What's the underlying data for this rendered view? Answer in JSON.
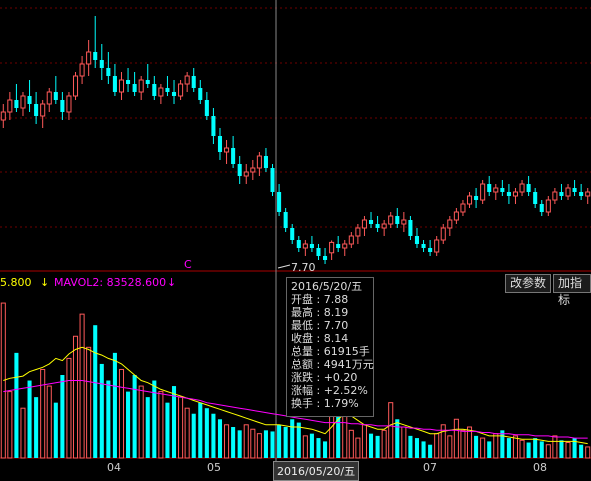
{
  "indicator": {
    "volume_label": "5.800",
    "mavol2_label": "MAVOL2: 83528.600",
    "down_arrow": "↓",
    "colors": {
      "yellow": "#ffff00",
      "magenta": "#ff00ff"
    }
  },
  "buttons": {
    "change_params": "改参数",
    "add_indicator": "加指标"
  },
  "price_low_label": "7.70",
  "marker_c": "C",
  "tooltip": {
    "date": "2016/5/20/五",
    "open": "开盘 : 7.88",
    "high": "最高 : 8.19",
    "low": "最低 : 7.70",
    "close": "收盘 : 8.14",
    "volume": "总量 : 61915手",
    "amount": "总额 : 4941万元",
    "change": "涨跌 : +0.20",
    "change_pct": "涨幅 : +2.52%",
    "turnover": "换手 : 1.79%"
  },
  "cursor_date": "2016/05/20/五",
  "chart_data": {
    "type": "bar",
    "x_ticks": [
      "04",
      "05",
      "07",
      "08"
    ],
    "colors": {
      "up": "#ff5a5a",
      "down": "#00ffff",
      "ma1": "#ffff00",
      "ma2": "#ff00ff",
      "grid": "#6e0000"
    },
    "candles": [
      [
        11.2,
        11.6,
        11.0,
        11.4
      ],
      [
        11.4,
        11.9,
        11.2,
        11.7
      ],
      [
        11.7,
        12.1,
        11.4,
        11.5
      ],
      [
        11.5,
        11.9,
        11.3,
        11.8
      ],
      [
        11.8,
        12.2,
        11.4,
        11.6
      ],
      [
        11.6,
        11.9,
        11.1,
        11.3
      ],
      [
        11.3,
        11.7,
        11.0,
        11.6
      ],
      [
        11.6,
        12.0,
        11.4,
        11.9
      ],
      [
        11.9,
        12.3,
        11.6,
        11.7
      ],
      [
        11.7,
        11.9,
        11.2,
        11.4
      ],
      [
        11.4,
        11.9,
        11.2,
        11.8
      ],
      [
        11.8,
        12.4,
        11.7,
        12.3
      ],
      [
        12.3,
        12.8,
        12.1,
        12.6
      ],
      [
        12.6,
        13.2,
        12.3,
        12.9
      ],
      [
        12.9,
        13.8,
        12.5,
        12.7
      ],
      [
        12.7,
        13.1,
        12.2,
        12.5
      ],
      [
        12.5,
        12.9,
        12.1,
        12.3
      ],
      [
        12.3,
        12.6,
        11.8,
        11.9
      ],
      [
        11.9,
        12.4,
        11.7,
        12.2
      ],
      [
        12.2,
        12.5,
        11.9,
        12.1
      ],
      [
        12.1,
        12.4,
        11.8,
        11.9
      ],
      [
        11.9,
        12.3,
        11.7,
        12.2
      ],
      [
        12.2,
        12.6,
        12.0,
        12.1
      ],
      [
        12.1,
        12.3,
        11.7,
        11.8
      ],
      [
        11.8,
        12.1,
        11.6,
        12.0
      ],
      [
        12.0,
        12.3,
        11.8,
        11.9
      ],
      [
        11.9,
        12.2,
        11.6,
        11.8
      ],
      [
        11.8,
        12.2,
        11.7,
        12.1
      ],
      [
        12.1,
        12.4,
        11.9,
        12.3
      ],
      [
        12.3,
        12.5,
        11.9,
        12.0
      ],
      [
        12.0,
        12.2,
        11.6,
        11.7
      ],
      [
        11.7,
        11.9,
        11.2,
        11.3
      ],
      [
        11.3,
        11.5,
        10.6,
        10.8
      ],
      [
        10.8,
        11.0,
        10.2,
        10.4
      ],
      [
        10.4,
        10.7,
        10.1,
        10.5
      ],
      [
        10.5,
        10.8,
        10.0,
        10.1
      ],
      [
        10.1,
        10.3,
        9.6,
        9.8
      ],
      [
        9.8,
        10.1,
        9.6,
        9.9
      ],
      [
        9.9,
        10.2,
        9.7,
        10.0
      ],
      [
        10.0,
        10.4,
        9.8,
        10.3
      ],
      [
        10.3,
        10.5,
        9.9,
        10.0
      ],
      [
        10.0,
        10.1,
        9.3,
        9.4
      ],
      [
        9.4,
        9.6,
        8.8,
        8.9
      ],
      [
        8.9,
        9.0,
        8.4,
        8.5
      ],
      [
        8.5,
        8.6,
        8.1,
        8.2
      ],
      [
        8.2,
        8.3,
        7.9,
        8.0
      ],
      [
        8.0,
        8.2,
        7.8,
        8.1
      ],
      [
        8.1,
        8.3,
        7.9,
        8.0
      ],
      [
        8.0,
        8.1,
        7.7,
        7.8
      ],
      [
        7.8,
        8.0,
        7.6,
        7.7
      ],
      [
        7.88,
        8.19,
        7.7,
        8.14
      ],
      [
        8.1,
        8.3,
        7.9,
        8.0
      ],
      [
        8.0,
        8.2,
        7.8,
        8.1
      ],
      [
        8.1,
        8.4,
        8.0,
        8.3
      ],
      [
        8.3,
        8.6,
        8.1,
        8.5
      ],
      [
        8.5,
        8.8,
        8.3,
        8.7
      ],
      [
        8.7,
        8.9,
        8.5,
        8.6
      ],
      [
        8.6,
        8.8,
        8.4,
        8.5
      ],
      [
        8.5,
        8.7,
        8.3,
        8.6
      ],
      [
        8.6,
        8.9,
        8.5,
        8.8
      ],
      [
        8.8,
        9.0,
        8.5,
        8.6
      ],
      [
        8.6,
        8.9,
        8.4,
        8.7
      ],
      [
        8.7,
        8.8,
        8.2,
        8.3
      ],
      [
        8.3,
        8.5,
        8.0,
        8.1
      ],
      [
        8.1,
        8.2,
        7.9,
        8.0
      ],
      [
        8.0,
        8.2,
        7.8,
        7.9
      ],
      [
        7.9,
        8.3,
        7.8,
        8.2
      ],
      [
        8.2,
        8.6,
        8.1,
        8.5
      ],
      [
        8.5,
        8.8,
        8.3,
        8.7
      ],
      [
        8.7,
        9.0,
        8.6,
        8.9
      ],
      [
        8.9,
        9.2,
        8.8,
        9.1
      ],
      [
        9.1,
        9.4,
        9.0,
        9.3
      ],
      [
        9.3,
        9.5,
        9.0,
        9.2
      ],
      [
        9.2,
        9.7,
        9.1,
        9.6
      ],
      [
        9.6,
        9.8,
        9.3,
        9.4
      ],
      [
        9.4,
        9.6,
        9.2,
        9.5
      ],
      [
        9.5,
        9.7,
        9.3,
        9.4
      ],
      [
        9.4,
        9.6,
        9.1,
        9.3
      ],
      [
        9.3,
        9.5,
        9.1,
        9.4
      ],
      [
        9.4,
        9.7,
        9.3,
        9.6
      ],
      [
        9.6,
        9.8,
        9.3,
        9.4
      ],
      [
        9.4,
        9.5,
        9.0,
        9.1
      ],
      [
        9.1,
        9.2,
        8.8,
        8.9
      ],
      [
        8.9,
        9.3,
        8.8,
        9.2
      ],
      [
        9.2,
        9.5,
        9.1,
        9.4
      ],
      [
        9.4,
        9.6,
        9.2,
        9.3
      ],
      [
        9.3,
        9.6,
        9.2,
        9.5
      ],
      [
        9.5,
        9.7,
        9.3,
        9.4
      ],
      [
        9.4,
        9.6,
        9.2,
        9.3
      ],
      [
        9.3,
        9.5,
        9.1,
        9.4
      ]
    ],
    "volume": [
      140,
      60,
      95,
      45,
      70,
      55,
      80,
      65,
      50,
      75,
      90,
      110,
      130,
      100,
      120,
      85,
      70,
      95,
      80,
      60,
      75,
      65,
      55,
      70,
      60,
      50,
      65,
      55,
      45,
      40,
      50,
      45,
      40,
      35,
      30,
      28,
      25,
      30,
      26,
      22,
      25,
      24,
      30,
      28,
      35,
      32,
      20,
      22,
      18,
      15,
      45,
      55,
      40,
      25,
      18,
      30,
      22,
      20,
      25,
      50,
      35,
      28,
      20,
      18,
      15,
      12,
      22,
      30,
      20,
      35,
      25,
      28,
      20,
      18,
      15,
      22,
      25,
      18,
      20,
      16,
      14,
      18,
      15,
      12,
      20,
      16,
      14,
      18,
      12,
      10
    ],
    "ma1": [
      70,
      72,
      73,
      74,
      78,
      80,
      82,
      85,
      90,
      88,
      94,
      98,
      100,
      98,
      95,
      93,
      90,
      88,
      85,
      80,
      75,
      70,
      68,
      65,
      62,
      60,
      58,
      56,
      54,
      52,
      50,
      48,
      46,
      44,
      42,
      40,
      38,
      36,
      34,
      32,
      30,
      30,
      30,
      29,
      28,
      28,
      27,
      26,
      24,
      22,
      28,
      35,
      40,
      38,
      34,
      30,
      28,
      26,
      26,
      30,
      32,
      30,
      28,
      26,
      24,
      22,
      22,
      24,
      25,
      26,
      26,
      25,
      24,
      22,
      20,
      20,
      20,
      19,
      18,
      17,
      17,
      17,
      16,
      15,
      15,
      15,
      15,
      15,
      14,
      13
    ],
    "ma2": [
      60,
      61,
      62,
      63,
      64,
      65,
      66,
      67,
      68,
      69,
      70,
      70,
      70,
      69,
      68,
      67,
      66,
      65,
      64,
      63,
      62,
      61,
      60,
      59,
      58,
      57,
      56,
      55,
      54,
      53,
      52,
      50,
      49,
      48,
      47,
      46,
      45,
      44,
      43,
      42,
      41,
      40,
      39,
      38,
      37,
      36,
      35,
      34,
      33,
      32,
      32,
      32,
      32,
      31,
      31,
      30,
      30,
      29,
      29,
      29,
      28,
      28,
      27,
      27,
      26,
      26,
      25,
      25,
      25,
      25,
      24,
      24,
      24,
      23,
      23,
      22,
      22,
      22,
      21,
      21,
      21,
      20,
      20,
      20,
      19,
      19,
      19,
      18,
      18,
      18
    ]
  }
}
